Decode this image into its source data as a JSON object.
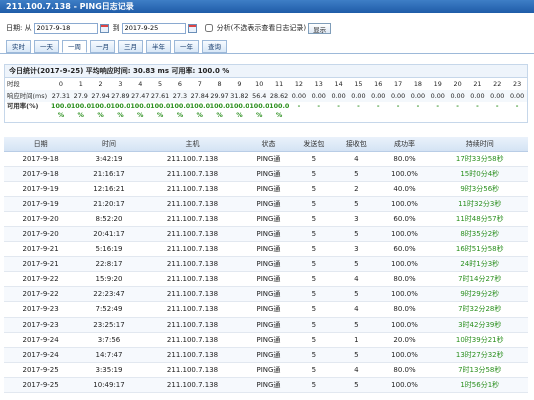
{
  "window": {
    "title": "211.100.7.138 - PING日志记录"
  },
  "filter": {
    "date_label": "日期: 从",
    "from_value": "2017-9-18",
    "to_label": "到",
    "to_value": "2017-9-25",
    "split_label": "分析(不选表示查看日志记录)",
    "show_button": "显示"
  },
  "tabs": [
    "实时",
    "一天",
    "一周",
    "一月",
    "三月",
    "半年",
    "一年",
    "查询"
  ],
  "stats": {
    "summary": "今日统计(2017-9-25) 平均响应时间: 30.83 ms 可用率: 100.0 %",
    "hour_label": "时段",
    "resp_label": "响应时间(ms)",
    "avail_label": "可用率(%)",
    "hours": [
      "0",
      "1",
      "2",
      "3",
      "4",
      "5",
      "6",
      "7",
      "8",
      "9",
      "10",
      "11",
      "12",
      "13",
      "14",
      "15",
      "16",
      "17",
      "18",
      "19",
      "20",
      "21",
      "22",
      "23"
    ],
    "resp": [
      "27.31",
      "27.9",
      "27.94",
      "27.89",
      "27.47",
      "27.61",
      "27.3",
      "27.84",
      "29.97",
      "31.82",
      "56.4",
      "28.62",
      "0.00",
      "0.00",
      "0.00",
      "0.00",
      "0.00",
      "0.00",
      "0.00",
      "0.00",
      "0.00",
      "0.00",
      "0.00",
      "0.00"
    ],
    "avail": [
      "100.0 %",
      "100.0 %",
      "100.0 %",
      "100.0 %",
      "100.0 %",
      "100.0 %",
      "100.0 %",
      "100.0 %",
      "100.0 %",
      "100.0 %",
      "100.0 %",
      "100.0 %",
      "-",
      "-",
      "-",
      "-",
      "-",
      "-",
      "-",
      "-",
      "-",
      "-",
      "-",
      "-"
    ]
  },
  "log": {
    "headers": [
      "日期",
      "时间",
      "主机",
      "状态",
      "发送包",
      "接收包",
      "成功率",
      "持续时间"
    ],
    "rows": [
      [
        "2017-9-18",
        "3:42:19",
        "211.100.7.138",
        "PING通",
        "5",
        "4",
        "80.0%",
        "17时33分58秒"
      ],
      [
        "2017-9-18",
        "21:16:17",
        "211.100.7.138",
        "PING通",
        "5",
        "5",
        "100.0%",
        "15时0分4秒"
      ],
      [
        "2017-9-19",
        "12:16:21",
        "211.100.7.138",
        "PING通",
        "5",
        "2",
        "40.0%",
        "9时3分56秒"
      ],
      [
        "2017-9-19",
        "21:20:17",
        "211.100.7.138",
        "PING通",
        "5",
        "5",
        "100.0%",
        "11时32分3秒"
      ],
      [
        "2017-9-20",
        "8:52:20",
        "211.100.7.138",
        "PING通",
        "5",
        "3",
        "60.0%",
        "11时48分57秒"
      ],
      [
        "2017-9-20",
        "20:41:17",
        "211.100.7.138",
        "PING通",
        "5",
        "5",
        "100.0%",
        "8时35分2秒"
      ],
      [
        "2017-9-21",
        "5:16:19",
        "211.100.7.138",
        "PING通",
        "5",
        "3",
        "60.0%",
        "16时51分58秒"
      ],
      [
        "2017-9-21",
        "22:8:17",
        "211.100.7.138",
        "PING通",
        "5",
        "5",
        "100.0%",
        "24时1分3秒"
      ],
      [
        "2017-9-22",
        "15:9:20",
        "211.100.7.138",
        "PING通",
        "5",
        "4",
        "80.0%",
        "7时14分27秒"
      ],
      [
        "2017-9-22",
        "22:23:47",
        "211.100.7.138",
        "PING通",
        "5",
        "5",
        "100.0%",
        "9时29分2秒"
      ],
      [
        "2017-9-23",
        "7:52:49",
        "211.100.7.138",
        "PING通",
        "5",
        "4",
        "80.0%",
        "7时32分28秒"
      ],
      [
        "2017-9-23",
        "23:25:17",
        "211.100.7.138",
        "PING通",
        "5",
        "5",
        "100.0%",
        "3时42分39秒"
      ],
      [
        "2017-9-24",
        "3:7:56",
        "211.100.7.138",
        "PING通",
        "5",
        "1",
        "20.0%",
        "10时39分21秒"
      ],
      [
        "2017-9-24",
        "14:7:47",
        "211.100.7.138",
        "PING通",
        "5",
        "5",
        "100.0%",
        "13时27分32秒"
      ],
      [
        "2017-9-25",
        "3:35:19",
        "211.100.7.138",
        "PING通",
        "5",
        "4",
        "80.0%",
        "7时13分58秒"
      ],
      [
        "2017-9-25",
        "10:49:17",
        "211.100.7.138",
        "PING通",
        "5",
        "5",
        "100.0%",
        "1时56分1秒"
      ]
    ]
  }
}
